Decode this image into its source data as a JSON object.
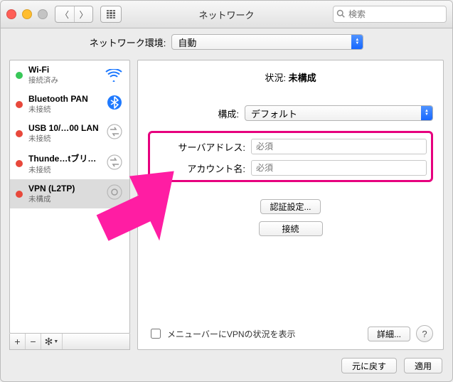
{
  "window": {
    "title": "ネットワーク"
  },
  "search": {
    "placeholder": "検索"
  },
  "location": {
    "label": "ネットワーク環境:",
    "value": "自動"
  },
  "sidebar": {
    "items": [
      {
        "name": "Wi-Fi",
        "sub": "接続済み",
        "dot": "green",
        "icon": "wifi"
      },
      {
        "name": "Bluetooth PAN",
        "sub": "未接続",
        "dot": "red",
        "icon": "bluetooth"
      },
      {
        "name": "USB 10/…00 LAN",
        "sub": "未接続",
        "dot": "red",
        "icon": "swap"
      },
      {
        "name": "Thunde…tブリッジ",
        "sub": "未接続",
        "dot": "red",
        "icon": "swap"
      },
      {
        "name": "VPN (L2TP)",
        "sub": "未構成",
        "dot": "red",
        "icon": "vpn",
        "selected": true
      }
    ],
    "footer": {
      "add": "+",
      "remove": "−",
      "settings": "✻▾"
    }
  },
  "detail": {
    "status_label": "状況:",
    "status_value": "未構成",
    "config_label": "構成:",
    "config_value": "デフォルト",
    "server_label": "サーバアドレス:",
    "server_placeholder": "必須",
    "account_label": "アカウント名:",
    "account_placeholder": "必須",
    "auth_button": "認証設定...",
    "connect_button": "接続",
    "menubar_checkbox": "メニューバーにVPNの状況を表示",
    "advanced_button": "詳細..."
  },
  "footer": {
    "revert": "元に戻す",
    "apply": "適用",
    "help": "?"
  }
}
